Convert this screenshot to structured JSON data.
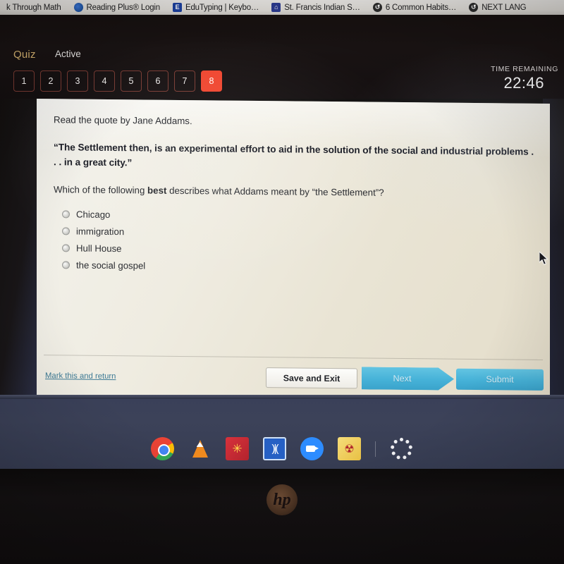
{
  "browser_tabs": [
    {
      "label": "k Through Math",
      "icon": "none"
    },
    {
      "label": "Reading Plus® Login",
      "icon": "readingplus-icon"
    },
    {
      "label": "EduTyping | Keybo…",
      "icon": "edutyping-icon"
    },
    {
      "label": "St. Francis Indian S…",
      "icon": "school-icon"
    },
    {
      "label": "6 Common Habits…",
      "icon": "refresh-icon"
    },
    {
      "label": "NEXT LANG",
      "icon": "refresh-icon"
    }
  ],
  "quiz_header": {
    "title": "Quiz",
    "state": "Active",
    "time_label": "TIME REMAINING",
    "time_value": "22:46",
    "question_numbers": [
      "1",
      "2",
      "3",
      "4",
      "5",
      "6",
      "7",
      "8"
    ],
    "active_question": "8",
    "accent_color": "#f0452e",
    "title_color": "#e8c37a"
  },
  "question": {
    "intro": "Read the quote by Jane Addams.",
    "quote": "“The Settlement then, is an experimental effort to aid in the solution of the social and industrial problems . . . in a great city.”",
    "prompt_before": "Which of the following ",
    "prompt_emphasis": "best",
    "prompt_after": " describes what Addams meant by “the Settlement”?",
    "options": [
      {
        "label": "Chicago",
        "selected": false
      },
      {
        "label": "immigration",
        "selected": false
      },
      {
        "label": "Hull House",
        "selected": false
      },
      {
        "label": "the social gospel",
        "selected": false
      }
    ]
  },
  "footer": {
    "mark_link": "Mark this and return",
    "save_exit": "Save and Exit",
    "next": "Next",
    "submit": "Submit",
    "link_color": "#3d7a95",
    "button_color": "#46b2d8"
  },
  "taskbar": {
    "icons": [
      {
        "name": "chrome-icon",
        "glyph": ""
      },
      {
        "name": "vlc-icon",
        "glyph": ""
      },
      {
        "name": "red-app-icon",
        "glyph": "✳"
      },
      {
        "name": "audio-waveform-icon",
        "glyph": ")|("
      },
      {
        "name": "zoom-icon",
        "glyph": ""
      },
      {
        "name": "yellow-app-icon",
        "glyph": "☢"
      },
      {
        "name": "loading-spinner-icon",
        "glyph": ""
      }
    ]
  },
  "laptop": {
    "brand": "hp"
  }
}
